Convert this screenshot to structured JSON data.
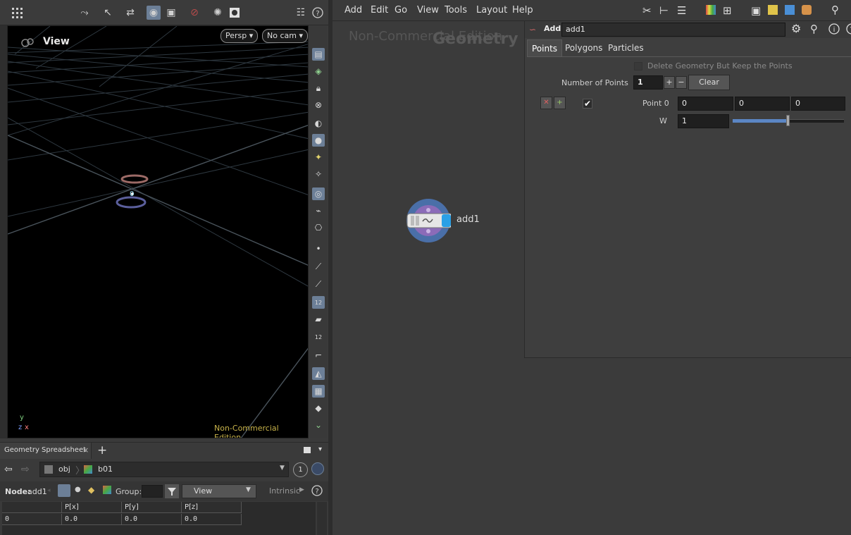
{
  "viewport": {
    "title": "View",
    "persp_label": "Persp",
    "cam_label": "No cam",
    "watermark": "Non-Commercial Edition",
    "point_label": "0",
    "axis_y": "y",
    "axis_x": "x",
    "axis_z": "z",
    "side_badge_1": "12",
    "side_badge_2": "12"
  },
  "spreadsheet": {
    "tab_label": "Geometry Spreadsheet",
    "path_obj": "obj",
    "path_node": "b01",
    "path_badge": "1",
    "node_prefix": "Node:",
    "node_name": "add1",
    "group_label": "Group:",
    "view_label": "View",
    "intrinsic_label": "Intrinsic",
    "columns": [
      "",
      "P[x]",
      "P[y]",
      "P[z]"
    ],
    "rows": [
      [
        "0",
        "0.0",
        "0.0",
        "0.0"
      ]
    ]
  },
  "menubar": {
    "items": [
      "Add",
      "Edit",
      "Go",
      "View",
      "Tools",
      "Layout",
      "Help"
    ]
  },
  "network": {
    "watermark": "Non-Commercial Edition",
    "context_label": "Geometry",
    "node_name": "add1"
  },
  "params": {
    "node_type": "Add",
    "node_name": "add1",
    "tabs": [
      "Points",
      "Polygons",
      "Particles"
    ],
    "delete_geo_label": "Delete Geometry But Keep the Points",
    "num_points_label": "Number of Points",
    "num_points_value": "1",
    "clear_label": "Clear",
    "point0_label": "Point 0",
    "point0_x": "0",
    "point0_y": "0",
    "point0_z": "0",
    "w_label": "W",
    "w_value": "1",
    "w_slider_fraction": 0.33
  },
  "colors": {
    "selected_icon": "#6c7f97",
    "watermark_yellow": "#c8b34a",
    "node_ring": "#4a6fa8",
    "node_inner": "#8b6bb8",
    "node_flag_blue": "#2aa0e6"
  }
}
